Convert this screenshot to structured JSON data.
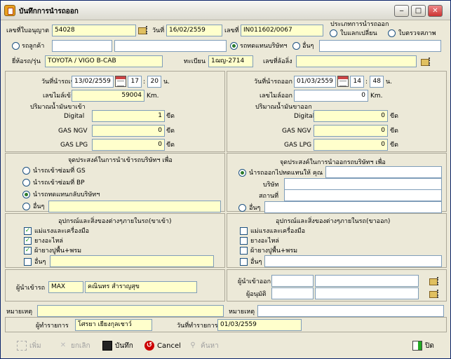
{
  "window": {
    "title": "บันทึกการนำรถออก",
    "btn_min": "‒",
    "btn_max": "□",
    "btn_close": "✕"
  },
  "top": {
    "license_label": "เลขที่ใบอนุญาต",
    "license_value": "54028",
    "date_label": "วันที่",
    "date_value": "16/02/2559",
    "docno_label": "เลขที่",
    "docno_value": "IN011602/0067",
    "exit_type_label": "ประเภทการนำรถออก",
    "exit_type_opt1": "ใบแลกเปลี่ยน",
    "exit_type_opt2": "ใบตรวจสภาพ",
    "customer_radio": "รถลูกค้า",
    "company_radio": "รถทดแทนบริษัทฯ",
    "other_radio": "อื่นๆ",
    "brand_label": "ยี่ห้อรถ/รุ่น",
    "brand_value": "TOYOTA / VIGO B-CAB",
    "plate_label": "ทะเบียน",
    "plate_value": "1ฌญ-2714",
    "trailer_label": "เลขที่ล้อลิ่ง"
  },
  "in": {
    "date_label": "วันที่นำรถเข้า",
    "date_value": "13/02/2559",
    "hour": "17",
    "minute": "20",
    "time_unit": "น.",
    "mile_label": "เลขไมล์เข้า",
    "mile_value": "59004",
    "mile_unit": "Km.",
    "fuel_label": "ปริมาณน้ำมันขาเข้า",
    "digital_label": "Digital",
    "digital_value": "1",
    "digital_unit": "ขีด",
    "ngv_label": "GAS NGV",
    "ngv_value": "0",
    "ngv_unit": "ขีด",
    "lpg_label": "GAS LPG",
    "lpg_value": "0",
    "lpg_unit": "ขีด",
    "purpose_title": "จุดประสงค์ในการนำเข้ารถบริษัทฯ เพื่อ",
    "purpose": [
      "นำรถเข้าซ่อมที่ GS",
      "นำรถเข้าซ่อมที่ BP",
      "นำรถทดแทนกลับบริษัทฯ",
      "อื่นๆ"
    ],
    "equip_title": "อุปกรณ์และสิ่งของต่างๆภายในรถ(ขาเข้า)",
    "equip": [
      "แม่แรงและเครื่องมือ",
      "ยางอะไหล่",
      "ผ้ายางปูพื้น+พรม",
      "อื่นๆ"
    ],
    "driver_label": "ผู้นำเข้ารถ",
    "driver_code": "MAX",
    "driver_name": "คณินทร สำราญสุข",
    "note_label": "หมายเหตุ"
  },
  "out": {
    "date_label": "วันที่นำรถออก",
    "date_value": "01/03/2559",
    "hour": "14",
    "minute": "48",
    "time_unit": "น.",
    "mile_label": "เลขไมล์ออก",
    "mile_value": "0",
    "mile_unit": "Km.",
    "fuel_label": "ปริมาณน้ำมันขาออก",
    "digital_label": "Digital",
    "digital_value": "0",
    "digital_unit": "ขีด",
    "ngv_label": "GAS NGV",
    "ngv_value": "0",
    "ngv_unit": "ขีด",
    "lpg_label": "GAS LPG",
    "lpg_value": "0",
    "lpg_unit": "ขีด",
    "purpose_title": "จุดประสงค์ในการนำออกรถบริษัทฯ เพื่อ",
    "purpose_opt1": "นำรถออกไปทดแทนให้ คุณ",
    "company_label": "บริษัท",
    "place_label": "สถานที่",
    "other_label": "อื่นๆ",
    "equip_title": "อุปกรณ์และสิ่งของต่างๆภายในรถ(ขาออก)",
    "equip": [
      "แม่แรงและเครื่องมือ",
      "ยางอะไหล่",
      "ผ้ายางปูพื้น+พรม",
      "อื่นๆ"
    ],
    "driver_label": "ผู้นำเข้าออก",
    "approver_label": "ผู้อนุมัติ",
    "note_label": "หมายเหตุ"
  },
  "footer": {
    "operator_label": "ผู้ทำรายการ",
    "operator_value": "โศรยา เยียงกุลเชาว์",
    "opdate_label": "วันที่ทำรายการ",
    "opdate_value": "01/03/2559"
  },
  "toolbar": {
    "add": "เพิ่ม",
    "cancel_doc": "ยกเลิก",
    "save": "บันทึก",
    "cancel": "Cancel",
    "search": "ค้นหา",
    "close": "ปิด"
  }
}
